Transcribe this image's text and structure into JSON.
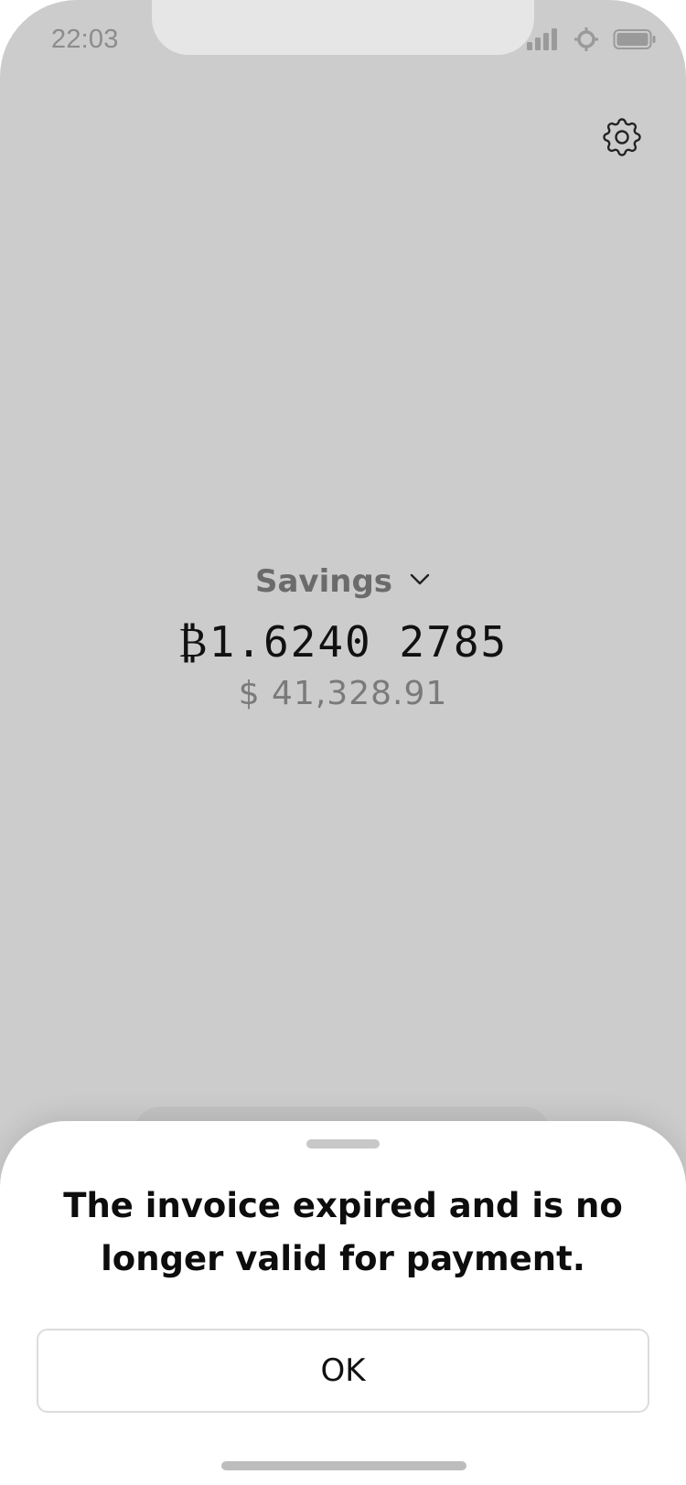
{
  "status_bar": {
    "time": "22:03",
    "icons": [
      "cellular-signal-icon",
      "network-node-icon",
      "battery-icon"
    ]
  },
  "header": {
    "settings_icon": "gear-icon"
  },
  "wallet": {
    "name": "Savings",
    "dropdown_icon": "chevron-down-icon",
    "btc_balance": "₿1.6240 2785",
    "fiat_balance": "$ 41,328.91"
  },
  "sheet": {
    "message": "The invoice expired and is no longer valid for payment.",
    "ok_label": "OK"
  },
  "colors": {
    "dimmed_background": "#cccccc",
    "sheet_background": "#ffffff",
    "primary_text": "#111111",
    "secondary_text": "#7a7a7a"
  }
}
